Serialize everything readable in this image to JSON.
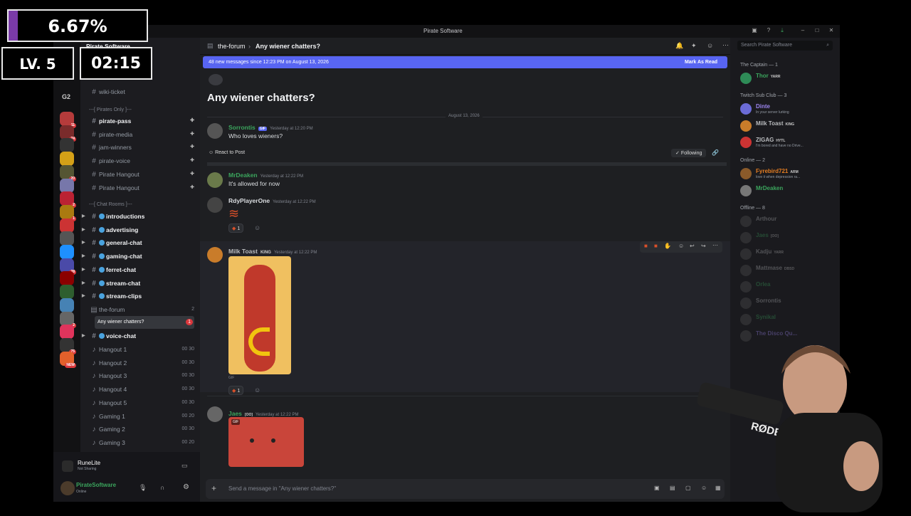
{
  "overlay": {
    "percent": "6.67%",
    "level": "LV. 5",
    "timer": "02:15",
    "progress_fraction": 0.0667
  },
  "window": {
    "title": "Pirate Software"
  },
  "servers": {
    "label_g2": "G2",
    "icons": [
      {
        "color": "#b53b3b",
        "badge": "11"
      },
      {
        "color": "#7a2b2b",
        "badge": "74"
      },
      {
        "color": "#333",
        "badge": ""
      },
      {
        "color": "#d4a017",
        "badge": ""
      },
      {
        "color": "#553",
        "badge": "20"
      },
      {
        "color": "#77a",
        "badge": ""
      },
      {
        "color": "#b23",
        "badge": "2"
      },
      {
        "color": "#aa7a10",
        "badge": "1"
      },
      {
        "color": "#c33",
        "badge": ""
      },
      {
        "color": "#555",
        "badge": ""
      },
      {
        "color": "#1e90ff",
        "badge": ""
      },
      {
        "color": "#4a4aa8",
        "badge": "28"
      },
      {
        "color": "#8b0000",
        "badge": ""
      },
      {
        "color": "#2e5e2e",
        "badge": ""
      },
      {
        "color": "#4682b4",
        "badge": ""
      },
      {
        "color": "#666",
        "badge": "2"
      },
      {
        "color": "#e0345c",
        "badge": ""
      },
      {
        "color": "#333",
        "badge": "75"
      },
      {
        "color": "#e2602b",
        "badge": "NEW"
      }
    ]
  },
  "channels": {
    "server_name": "Pirate Software",
    "wiki": "wiki-ticket",
    "cat_pirates": "---[ Pirates Only ]---",
    "pirates": [
      "pirate-pass",
      "pirate-media",
      "jam-winners",
      "pirate-voice",
      "Pirate Hangout",
      "Pirate Hangout"
    ],
    "cat_chat": "---[ Chat Rooms ]---",
    "chat": [
      "introductions",
      "advertising",
      "general-chat",
      "gaming-chat",
      "ferret-chat",
      "stream-chat",
      "stream-clips"
    ],
    "forum": "the-forum",
    "forum_count": "2",
    "thread": "Any wiener chatters?",
    "thread_badge": "1",
    "voice_chat": "voice-chat",
    "voice": [
      {
        "name": "Hangout 1",
        "a": "00",
        "b": "30"
      },
      {
        "name": "Hangout 2",
        "a": "00",
        "b": "30"
      },
      {
        "name": "Hangout 3",
        "a": "00",
        "b": "30"
      },
      {
        "name": "Hangout 4",
        "a": "00",
        "b": "30"
      },
      {
        "name": "Hangout 5",
        "a": "00",
        "b": "30"
      },
      {
        "name": "Gaming 1",
        "a": "00",
        "b": "20"
      },
      {
        "name": "Gaming 2",
        "a": "00",
        "b": "30"
      },
      {
        "name": "Gaming 3",
        "a": "00",
        "b": "20"
      }
    ]
  },
  "activity": {
    "name": "RuneLite",
    "status": "Not Sharing"
  },
  "user": {
    "name": "PirateSoftware",
    "status": "Online"
  },
  "header": {
    "channel": "the-forum",
    "thread": "Any wiener chatters?",
    "search_placeholder": "Search Pirate Software"
  },
  "banner": {
    "text": "48 new messages since 12:23 PM on August 13, 2026",
    "action": "Mark As Read"
  },
  "post": {
    "title": "Any wiener chatters?",
    "date_divider": "August 13, 2026",
    "author": "Sorrontis",
    "tag": "GIF",
    "time": "Yesterday at 12:20 PM",
    "text": "Who loves wieners?",
    "react_label": "React to Post",
    "following": "Following"
  },
  "messages": [
    {
      "author": "MrDeaken",
      "color": "#3ba55d",
      "time": "Yesterday at 12:22 PM",
      "text": "It's allowed for now"
    },
    {
      "author": "RdyPlayerOne",
      "color": "#dbdee1",
      "time": "Yesterday at 12:22 PM",
      "text": "",
      "reaction": "1"
    },
    {
      "author": "Milk Toast",
      "color": "#b9bbbe",
      "tag": "KING",
      "time": "Yesterday at 12:22 PM",
      "gif_label": "GIF",
      "reaction": "1"
    },
    {
      "author": "Jaes",
      "color": "#3ba55d",
      "tag": "[OO]",
      "time": "Yesterday at 12:22 PM",
      "gif_label": "GIF"
    }
  ],
  "composer": {
    "placeholder": "Send a message in \"Any wiener chatters?\""
  },
  "members": {
    "groups": [
      {
        "title": "The Captain — 1",
        "items": [
          {
            "name": "Thor",
            "tag": "YARR",
            "color": "#3ba55d",
            "status": "",
            "av": "#2e8b57"
          }
        ]
      },
      {
        "title": "Twitch Sub Club — 3",
        "items": [
          {
            "name": "Dinte",
            "tag": "",
            "color": "#9b84ee",
            "status": "In your server lurking",
            "av": "#6b6bd6"
          },
          {
            "name": "Milk Toast",
            "tag": "KING",
            "color": "#b9bbbe",
            "status": "",
            "av": "#c97c2a"
          },
          {
            "name": "ZIGAG",
            "tag": "HYTL",
            "color": "#b9bbbe",
            "status": "I'm bored and have no Drive...",
            "av": "#c33"
          }
        ]
      },
      {
        "title": "Online — 2",
        "items": [
          {
            "name": "Fyrebird721",
            "tag": "ARM",
            "color": "#e67e22",
            "status": "love it when depression ra...",
            "av": "#8a5a2a"
          },
          {
            "name": "MrDeaken",
            "tag": "",
            "color": "#3ba55d",
            "status": "",
            "av": "#777"
          }
        ]
      },
      {
        "title": "Offline — 8",
        "items": [
          {
            "name": "Arthour",
            "tag": "",
            "color": "#b9bbbe",
            "status": "",
            "av": "#555",
            "off": true
          },
          {
            "name": "Jaes",
            "tag": "[OO]",
            "color": "#3ba55d",
            "status": "",
            "av": "#555",
            "off": true
          },
          {
            "name": "Kadju",
            "tag": "YARR",
            "color": "#b9bbbe",
            "status": "",
            "av": "#555",
            "off": true
          },
          {
            "name": "Mattmase",
            "tag": "DBSD",
            "color": "#b9bbbe",
            "status": "",
            "av": "#555",
            "off": true
          },
          {
            "name": "Orlea",
            "tag": "",
            "color": "#3ba55d",
            "status": "",
            "av": "#555",
            "off": true
          },
          {
            "name": "Sorrontis",
            "tag": "",
            "color": "#b9bbbe",
            "status": "",
            "av": "#555",
            "off": true
          },
          {
            "name": "Synikal",
            "tag": "",
            "color": "#3ba55d",
            "status": "",
            "av": "#555",
            "off": true
          },
          {
            "name": "The Disco Qu...",
            "tag": "",
            "color": "#9b84ee",
            "status": "",
            "av": "#555",
            "off": true
          }
        ]
      }
    ]
  },
  "webcam": {
    "mic_brand": "RØDE"
  }
}
